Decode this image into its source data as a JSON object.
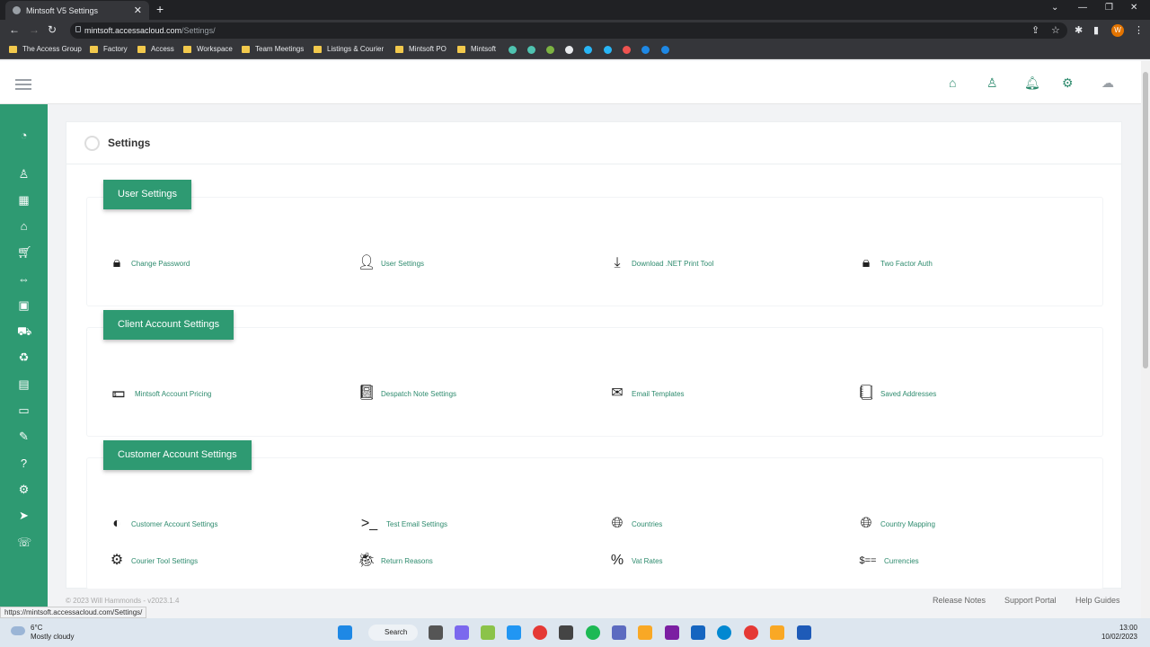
{
  "browser": {
    "tab_title": "Mintsoft V5 Settings",
    "url_host": "mintsoft.accessacloud.com",
    "url_path": "/Settings/",
    "bookmarks": [
      "The Access Group",
      "Factory",
      "Access",
      "Workspace",
      "Team Meetings",
      "Listings & Courier",
      "Mintsoft PO",
      "Mintsoft"
    ],
    "profile_initial": "W",
    "status_url": "https://mintsoft.accessacloud.com/Settings/"
  },
  "page": {
    "title": "Settings"
  },
  "sections": [
    {
      "title": "User Settings",
      "items": [
        {
          "label": "Change Password",
          "icon": "lock-icon"
        },
        {
          "label": "User Settings",
          "icon": "user-icon"
        },
        {
          "label": "Download .NET Print Tool",
          "icon": "download-icon"
        },
        {
          "label": "Two Factor Auth",
          "icon": "lock-icon"
        }
      ]
    },
    {
      "title": "Client Account Settings",
      "items": [
        {
          "label": "Mintsoft Account Pricing",
          "icon": "money-icon"
        },
        {
          "label": "Despatch Note Settings",
          "icon": "book-icon"
        },
        {
          "label": "Email Templates",
          "icon": "envelope-icon"
        },
        {
          "label": "Saved Addresses",
          "icon": "address-book-icon"
        }
      ]
    },
    {
      "title": "Customer Account Settings",
      "items": [
        {
          "label": "Customer Account Settings",
          "icon": "contrast-icon"
        },
        {
          "label": "Test Email Settings",
          "icon": "terminal-icon"
        },
        {
          "label": "Countries",
          "icon": "globe-icon"
        },
        {
          "label": "Country Mapping",
          "icon": "globe-icon"
        },
        {
          "label": "Courier Tool Settings",
          "icon": "gear-icon"
        },
        {
          "label": "Return Reasons",
          "icon": "bug-icon"
        },
        {
          "label": "Vat Rates",
          "icon": "percent-icon"
        },
        {
          "label": "Currencies",
          "icon": "currency-icon"
        }
      ]
    }
  ],
  "footer": {
    "copyright": "© 2023 Will Hammonds - v2023.1.4",
    "links": [
      "Release Notes",
      "Support Portal",
      "Help Guides"
    ]
  },
  "taskbar": {
    "weather_temp": "6°C",
    "weather_desc": "Mostly cloudy",
    "search_label": "Search",
    "time": "13:00",
    "date": "10/02/2023"
  },
  "colors": {
    "brand_green": "#2e9a72",
    "link_green": "#2e8b6e"
  }
}
